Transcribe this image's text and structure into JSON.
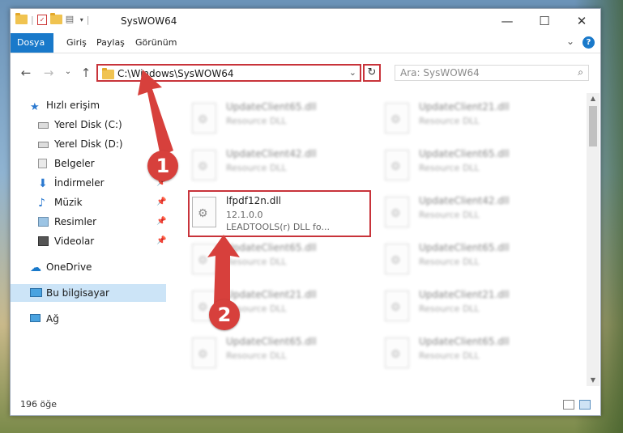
{
  "window": {
    "title": "SysWOW64",
    "minimize": "—",
    "maximize": "☐",
    "close": "✕"
  },
  "ribbon": {
    "tabs": [
      "Dosya",
      "Giriş",
      "Paylaş",
      "Görünüm"
    ],
    "expand": "⌄",
    "help": "?"
  },
  "nav": {
    "back": "←",
    "forward": "→",
    "recent": "⌄",
    "up": "↑"
  },
  "address": {
    "path": "C:\\Windows\\SysWOW64",
    "dropdown": "⌄",
    "refresh": "↻"
  },
  "search": {
    "placeholder": "Ara: SysWOW64",
    "icon": "search-icon"
  },
  "sidebar": {
    "items": [
      {
        "label": "Hızlı erişim",
        "icon": "star-icon",
        "pinned": false
      },
      {
        "label": "Yerel Disk (C:)",
        "icon": "drive-icon",
        "pinned": true
      },
      {
        "label": "Yerel Disk (D:)",
        "icon": "drive-icon",
        "pinned": true
      },
      {
        "label": "Belgeler",
        "icon": "documents-icon",
        "pinned": true
      },
      {
        "label": "İndirmeler",
        "icon": "download-icon",
        "pinned": true
      },
      {
        "label": "Müzik",
        "icon": "music-icon",
        "pinned": true
      },
      {
        "label": "Resimler",
        "icon": "pictures-icon",
        "pinned": true
      },
      {
        "label": "Videolar",
        "icon": "videos-icon",
        "pinned": true
      },
      {
        "label": "OneDrive",
        "icon": "cloud-icon",
        "pinned": false
      },
      {
        "label": "Bu bilgisayar",
        "icon": "computer-icon",
        "pinned": false
      },
      {
        "label": "Ağ",
        "icon": "network-icon",
        "pinned": false
      }
    ]
  },
  "files": {
    "left": [
      {
        "name": "UpdateClient65.dll",
        "desc": "Resource DLL"
      },
      {
        "name": "UpdateClient42.dll",
        "desc": "Resource DLL"
      },
      {
        "name": "UpdateClient65.dll",
        "desc": "Resource DLL"
      },
      {
        "name": "UpdateClient21.dll",
        "desc": "Resource DLL"
      },
      {
        "name": "UpdateClient65.dll",
        "desc": "Resource DLL"
      }
    ],
    "right": [
      {
        "name": "UpdateClient21.dll",
        "desc": "Resource DLL"
      },
      {
        "name": "UpdateClient65.dll",
        "desc": "Resource DLL"
      },
      {
        "name": "UpdateClient42.dll",
        "desc": "Resource DLL"
      },
      {
        "name": "UpdateClient65.dll",
        "desc": "Resource DLL"
      },
      {
        "name": "UpdateClient21.dll",
        "desc": "Resource DLL"
      },
      {
        "name": "UpdateClient65.dll",
        "desc": "Resource DLL"
      }
    ],
    "highlighted": {
      "name": "lfpdf12n.dll",
      "version": "12.1.0.0",
      "desc": "LEADTOOLS(r) DLL fo..."
    }
  },
  "annotations": {
    "step1": "1",
    "step2": "2",
    "color": "#d7403c"
  },
  "status": {
    "count": "196 öğe"
  }
}
